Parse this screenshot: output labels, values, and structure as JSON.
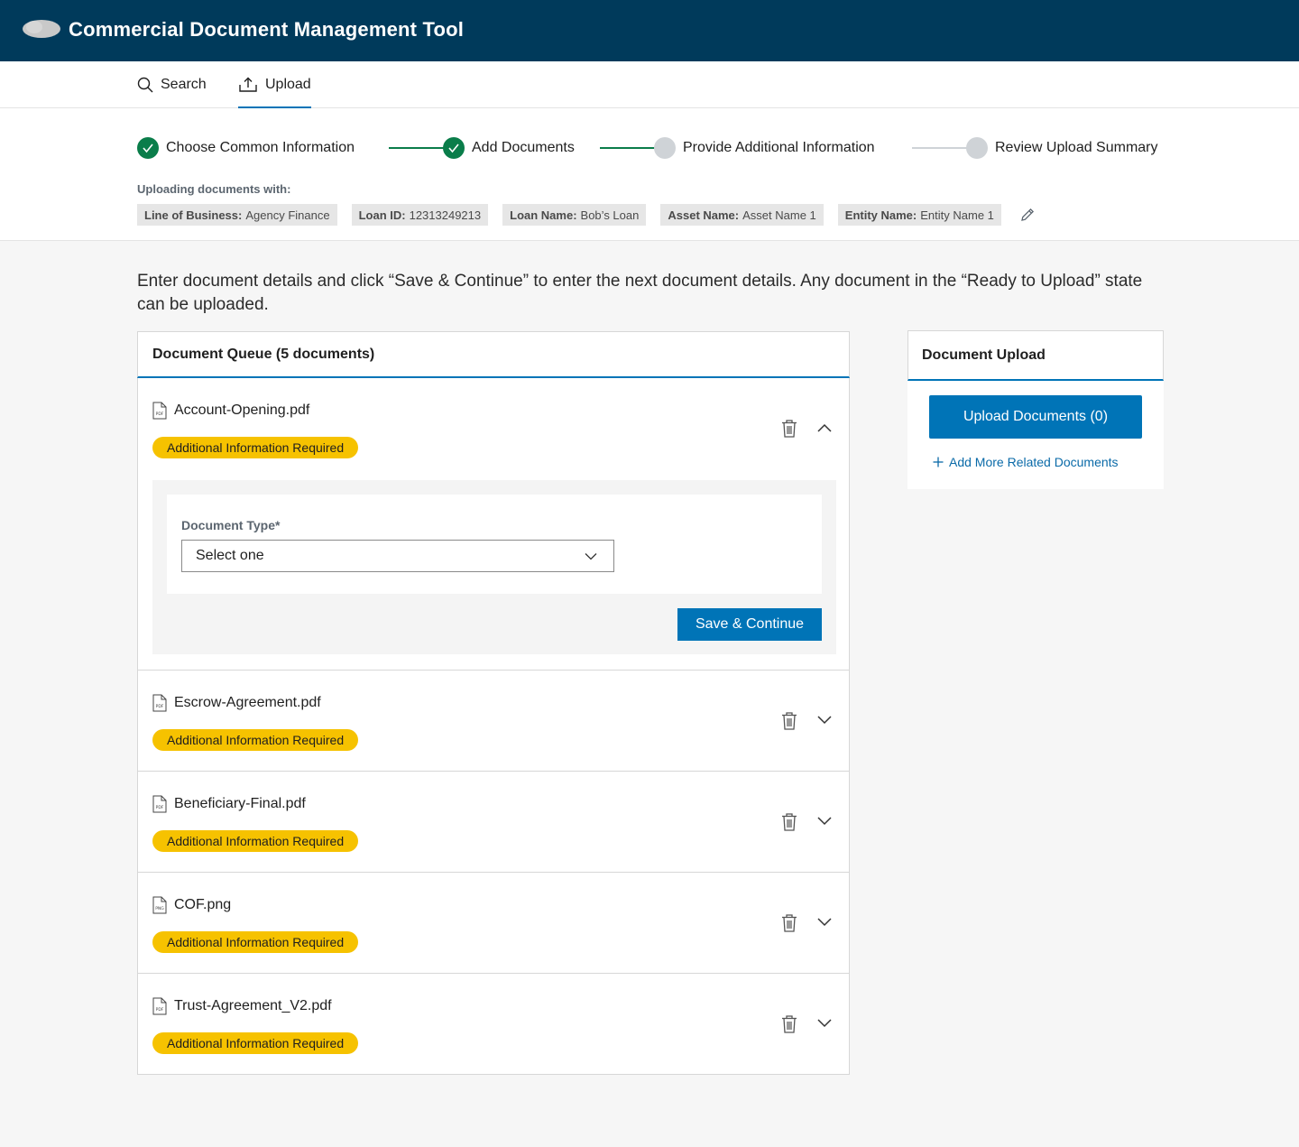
{
  "app": {
    "title": "Commercial Document Management Tool"
  },
  "nav": {
    "search_label": "Search",
    "upload_label": "Upload"
  },
  "stepper": {
    "steps": [
      {
        "label": "Choose Common Information",
        "state": "complete"
      },
      {
        "label": "Add Documents",
        "state": "complete"
      },
      {
        "label": "Provide Additional Information",
        "state": "pending"
      },
      {
        "label": "Review Upload Summary",
        "state": "pending"
      }
    ]
  },
  "context": {
    "label": "Uploading documents with:",
    "chips": [
      {
        "key": "Line of Business:",
        "value": "Agency Finance"
      },
      {
        "key": "Loan ID:",
        "value": "12313249213"
      },
      {
        "key": "Loan Name:",
        "value": "Bob’s Loan"
      },
      {
        "key": "Asset Name:",
        "value": "Asset Name 1"
      },
      {
        "key": "Entity Name:",
        "value": "Entity Name 1"
      }
    ]
  },
  "instructions": "Enter document details and click “Save & Continue” to enter the next document details. Any document in the “Ready to Upload” state can be uploaded.",
  "queue": {
    "title": "Document Queue (5 documents)",
    "documents": [
      {
        "name": "Account-Opening.pdf",
        "file_type": "PDF",
        "status": "Additional Information Required",
        "expanded": true
      },
      {
        "name": "Escrow-Agreement.pdf",
        "file_type": "PDF",
        "status": "Additional Information Required",
        "expanded": false
      },
      {
        "name": "Beneficiary-Final.pdf",
        "file_type": "PDF",
        "status": "Additional Information Required",
        "expanded": false
      },
      {
        "name": "COF.png",
        "file_type": "PNG",
        "status": "Additional Information Required",
        "expanded": false
      },
      {
        "name": "Trust-Agreement_V2.pdf",
        "file_type": "PDF",
        "status": "Additional Information Required",
        "expanded": false
      }
    ],
    "form": {
      "doc_type_label": "Document Type*",
      "doc_type_value": "Select one",
      "save_label": "Save & Continue"
    }
  },
  "upload_panel": {
    "title": "Document Upload",
    "upload_button": "Upload Documents (0)",
    "add_more": "Add More Related Documents"
  },
  "colors": {
    "header_bg": "#003a5b",
    "primary": "#0074b7",
    "success": "#0a7d4a",
    "warning_badge": "#f6c200"
  }
}
